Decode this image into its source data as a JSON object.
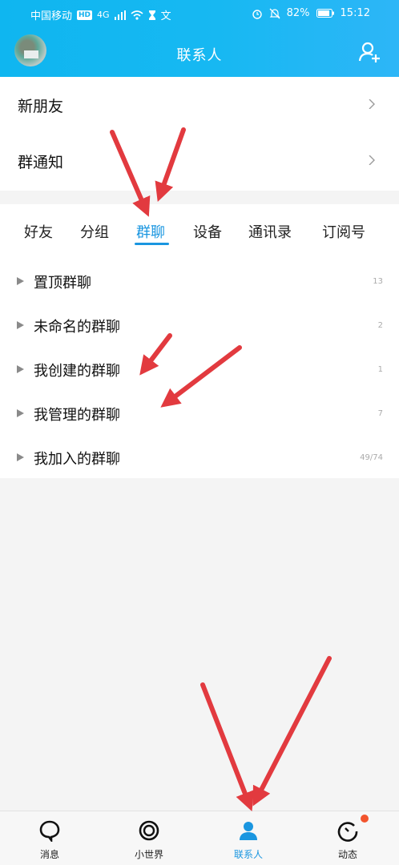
{
  "status_bar": {
    "carrier": "中国移动",
    "hd": "HD",
    "net": "4G",
    "input_char": "文",
    "battery": "82%",
    "time": "15:12"
  },
  "header": {
    "title": "联系人"
  },
  "entries": [
    {
      "label": "新朋友"
    },
    {
      "label": "群通知"
    }
  ],
  "tabs": [
    {
      "label": "好友"
    },
    {
      "label": "分组"
    },
    {
      "label": "群聊",
      "active": true
    },
    {
      "label": "设备"
    },
    {
      "label": "通讯录"
    },
    {
      "label": "订阅号"
    }
  ],
  "groups": [
    {
      "name": "置顶群聊",
      "count": "13"
    },
    {
      "name": "未命名的群聊",
      "count": "2"
    },
    {
      "name": "我创建的群聊",
      "count": "1"
    },
    {
      "name": "我管理的群聊",
      "count": "7"
    },
    {
      "name": "我加入的群聊",
      "count": "49/74"
    }
  ],
  "bottom_nav": [
    {
      "label": "消息",
      "icon": "message-icon"
    },
    {
      "label": "小世界",
      "icon": "small-world-icon"
    },
    {
      "label": "联系人",
      "icon": "contacts-icon",
      "active": true
    },
    {
      "label": "动态",
      "icon": "moments-icon"
    }
  ],
  "colors": {
    "header": "#17b8f2",
    "accent": "#1a96e0",
    "arrow": "#e23a3f",
    "badge": "#f2542d"
  }
}
